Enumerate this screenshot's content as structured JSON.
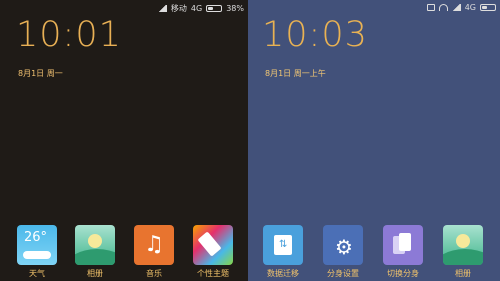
{
  "left": {
    "status": {
      "carrier": "移动",
      "network": "4G",
      "battery": "38%"
    },
    "time": "10:01",
    "date": "8月1日 周一",
    "apps": [
      {
        "label": "天气",
        "temp": "26°",
        "icon": "weather-icon"
      },
      {
        "label": "相册",
        "icon": "gallery-icon"
      },
      {
        "label": "音乐",
        "icon": "music-icon"
      },
      {
        "label": "个性主题",
        "icon": "theme-icon"
      }
    ]
  },
  "right": {
    "status": {
      "network": "4G"
    },
    "time": "10:03",
    "date": "8月1日 周一上午",
    "apps": [
      {
        "label": "数据迁移",
        "icon": "data-migrate-icon"
      },
      {
        "label": "分身设置",
        "icon": "dual-settings-icon"
      },
      {
        "label": "切换分身",
        "icon": "switch-dual-icon"
      },
      {
        "label": "相册",
        "icon": "gallery-icon"
      }
    ]
  },
  "colors": {
    "accent": "#e8b055",
    "left_bg": "#1f1b17",
    "right_bg": "#42517a"
  }
}
